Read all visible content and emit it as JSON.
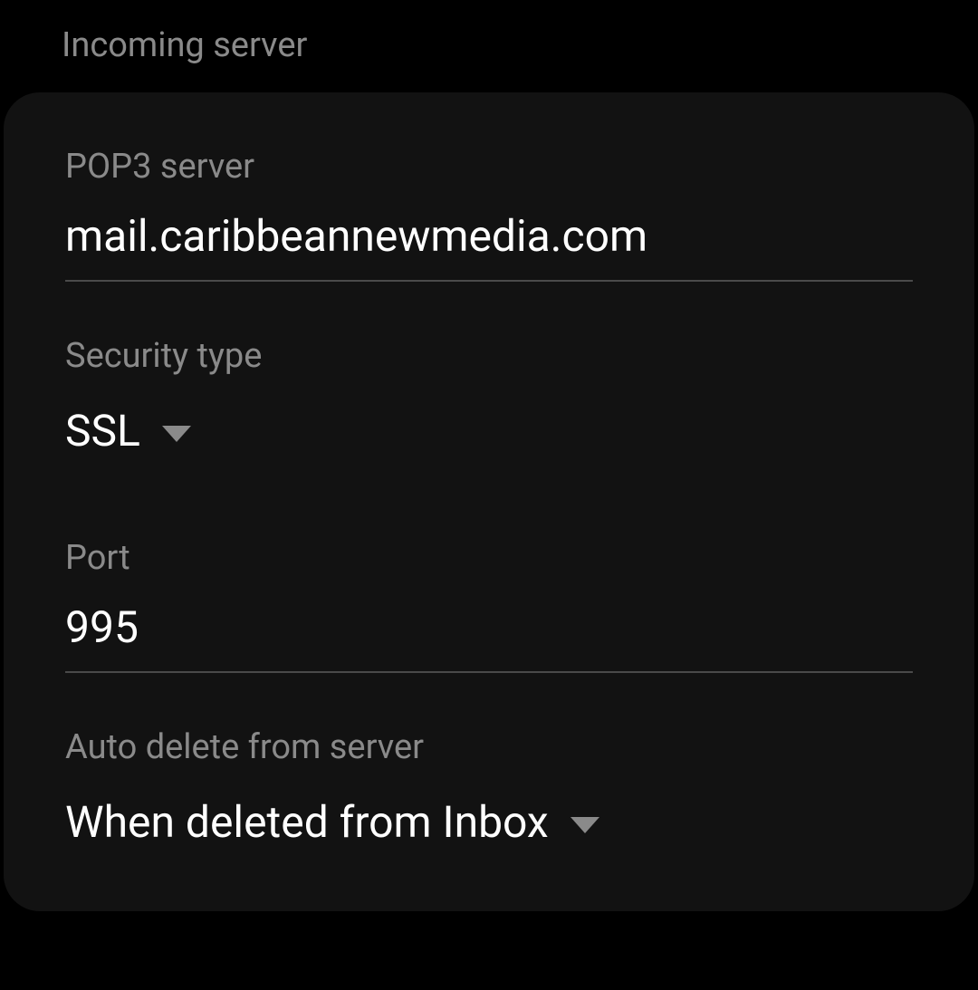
{
  "section": {
    "title": "Incoming server"
  },
  "fields": {
    "pop3_server": {
      "label": "POP3 server",
      "value": "mail.caribbeannewmedia.com"
    },
    "security_type": {
      "label": "Security type",
      "value": "SSL"
    },
    "port": {
      "label": "Port",
      "value": "995"
    },
    "auto_delete": {
      "label": "Auto delete from server",
      "value": "When deleted from Inbox"
    }
  }
}
